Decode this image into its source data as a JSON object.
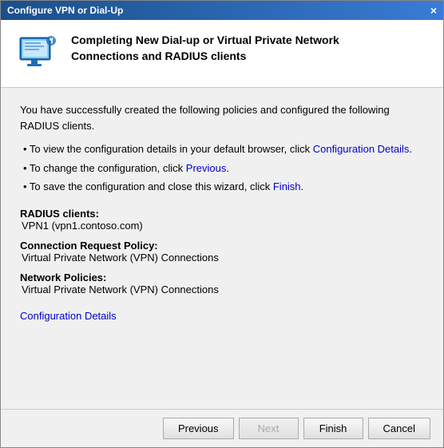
{
  "window": {
    "title": "Configure VPN or Dial-Up",
    "close_label": "×"
  },
  "header": {
    "title_line1": "Completing New Dial-up or Virtual Private Network",
    "title_line2": "Connections and RADIUS clients"
  },
  "content": {
    "intro": "You have successfully created the following policies and configured the following RADIUS clients.",
    "bullets": [
      {
        "prefix": "• To view the configuration details in your default browser, click ",
        "link_text": "Configuration Details",
        "suffix": "."
      },
      {
        "prefix": "• To change the configuration, click ",
        "link_text": "Previous",
        "suffix": "."
      },
      {
        "prefix": "• To save the configuration and close this wizard, click ",
        "link_text": "Finish",
        "suffix": "."
      }
    ],
    "radius_label": "RADIUS clients:",
    "radius_value": "VPN1 (vpn1.contoso.com)",
    "connection_label": "Connection Request Policy:",
    "connection_value": "Virtual Private Network (VPN) Connections",
    "network_label": "Network Policies:",
    "network_value": "Virtual Private Network (VPN) Connections",
    "config_link": "Configuration Details"
  },
  "footer": {
    "previous_label": "Previous",
    "next_label": "Next",
    "finish_label": "Finish",
    "cancel_label": "Cancel"
  }
}
